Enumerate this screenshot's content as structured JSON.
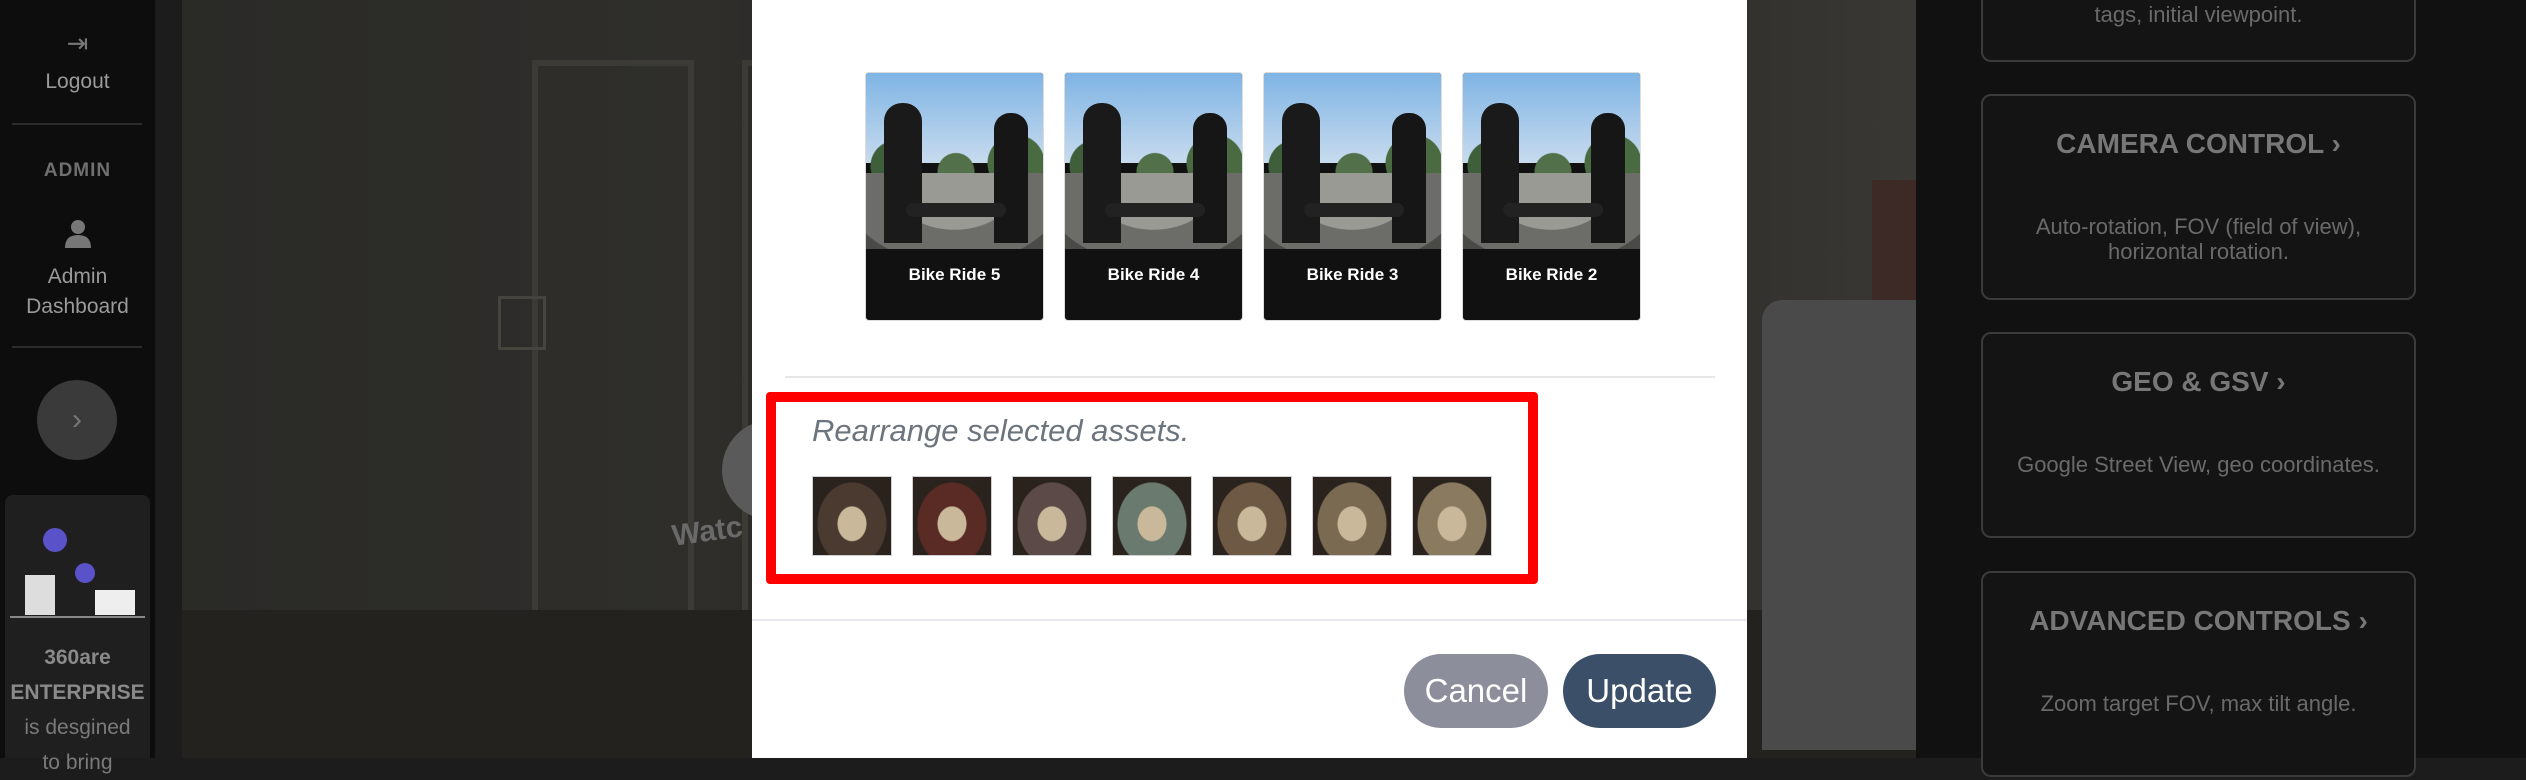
{
  "sidebar": {
    "logout_label": "Logout",
    "admin_heading": "ADMIN",
    "admin_dashboard_label": "Admin Dashboard",
    "promo_brand": "360are",
    "promo_product": "ENTERPRISE",
    "promo_text": "is desgined",
    "promo_text2": "to bring"
  },
  "background": {
    "watch_text": "Watc"
  },
  "controls": [
    {
      "title": "",
      "desc": "tags, initial viewpoint."
    },
    {
      "title": "CAMERA CONTROL ›",
      "desc": "Auto-rotation, FOV (field of view), horizontal rotation."
    },
    {
      "title": "GEO & GSV ›",
      "desc": "Google Street View, geo coordinates."
    },
    {
      "title": "ADVANCED CONTROLS ›",
      "desc": "Zoom target FOV, max tilt angle."
    }
  ],
  "modal": {
    "assets": [
      {
        "label": "Bike Ride 5"
      },
      {
        "label": "Bike Ride 4"
      },
      {
        "label": "Bike Ride 3"
      },
      {
        "label": "Bike Ride 2"
      }
    ],
    "rearrange_label": "Rearrange selected assets.",
    "selected_thumbs": [
      {
        "color": "#4a3a30"
      },
      {
        "color": "#5a2a24"
      },
      {
        "color": "#5c4a48"
      },
      {
        "color": "#6a7a6e"
      },
      {
        "color": "#6e5a44"
      },
      {
        "color": "#7a6a52"
      },
      {
        "color": "#8a7a60"
      }
    ],
    "cancel_label": "Cancel",
    "update_label": "Update"
  },
  "colors": {
    "highlight": "#ff0000",
    "update_button": "#3b5068",
    "cancel_button": "#8c8e9c"
  }
}
